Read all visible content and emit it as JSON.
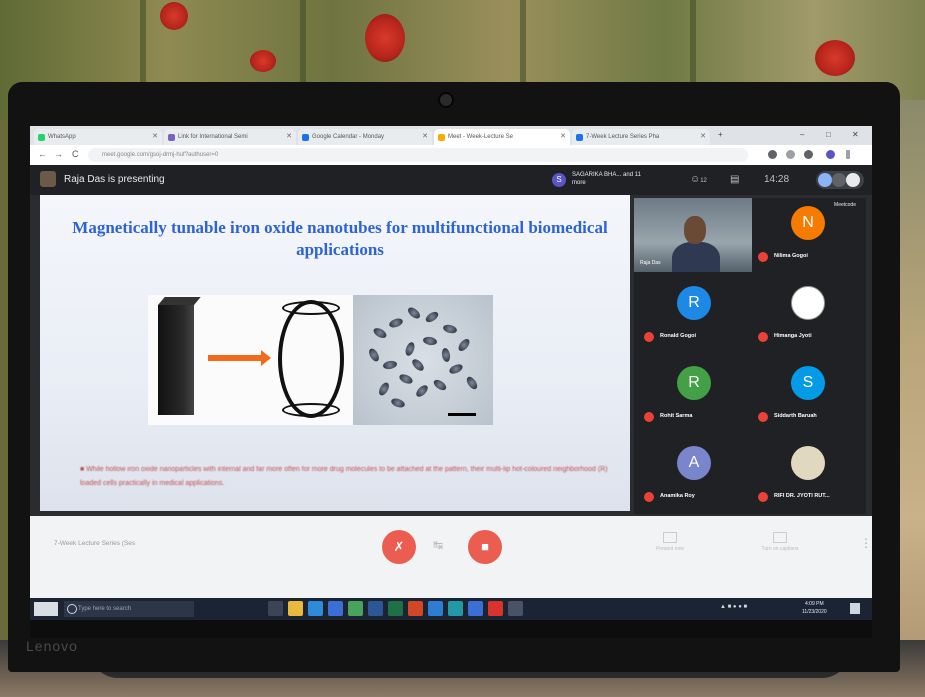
{
  "browser": {
    "tabs": [
      {
        "label": "WhatsApp",
        "color": "#25d366",
        "active": false
      },
      {
        "label": "Link for International Semi",
        "color": "#7b61c4",
        "active": false
      },
      {
        "label": "Google Calendar - Monday",
        "color": "#1a73e8",
        "active": false
      },
      {
        "label": "Meet - Week-Lecture Se",
        "color": "#f9ab00",
        "active": true
      },
      {
        "label": "7-Week Lecture Series Pha",
        "color": "#1a73e8",
        "active": false
      }
    ],
    "new_tab": "+",
    "window_controls": [
      "–",
      "□",
      "✕"
    ],
    "nav": [
      "←",
      "→",
      "C"
    ],
    "url": "meet.google.com/gsoj-drmj-huf?authuser=0"
  },
  "meet": {
    "presenting_label": "Raja Das is presenting",
    "attendee_initial": "S",
    "attendee_summary": "SAGARIKA BHA... and 11 more",
    "top_icons": [
      "people-icon",
      "chat-icon"
    ],
    "people_count": "12",
    "time": "14:28",
    "panel_tag": "Meetcode",
    "video_name": "Raja Das"
  },
  "slide": {
    "title": "Magnetically tunable iron oxide nanotubes for multifunctional biomedical applications",
    "text": "While hollow iron oxide nanoparticles with internal and far more often for more drug molecules to be attached at the pattern, their multi-lip hot-coloured neighborhood (R) loaded cells practically in medical applications."
  },
  "participants": [
    {
      "name": "Nilima Gogoi",
      "initial": "N",
      "color": "#f57c00"
    },
    {
      "name": "Ronald Gogoi",
      "initial": "R",
      "color": "#1e88e5"
    },
    {
      "name": "Himanga Jyoti",
      "initial": "",
      "color": "#ffffff"
    },
    {
      "name": "Rohit Sarma",
      "initial": "R",
      "color": "#43a047"
    },
    {
      "name": "Siddarth Baruah",
      "initial": "S",
      "color": "#039be5"
    },
    {
      "name": "Anamika Roy",
      "initial": "A",
      "color": "#7986cb"
    },
    {
      "name": "RIFI DR. JYOTI RUT...",
      "initial": "",
      "color": "#e0d9c0"
    }
  ],
  "controls": {
    "lecture_label": "7-Week Lecture Series (Ses",
    "mic_icon": "mic-off-icon",
    "camera_icon": "camera-off-icon",
    "present_label": "Present now",
    "captions_label": "Turn on captions"
  },
  "taskbar": {
    "search_placeholder": "Type here to search",
    "time": "4:09 PM",
    "date": "11/23/2020"
  },
  "laptop_brand": "Lenovo"
}
